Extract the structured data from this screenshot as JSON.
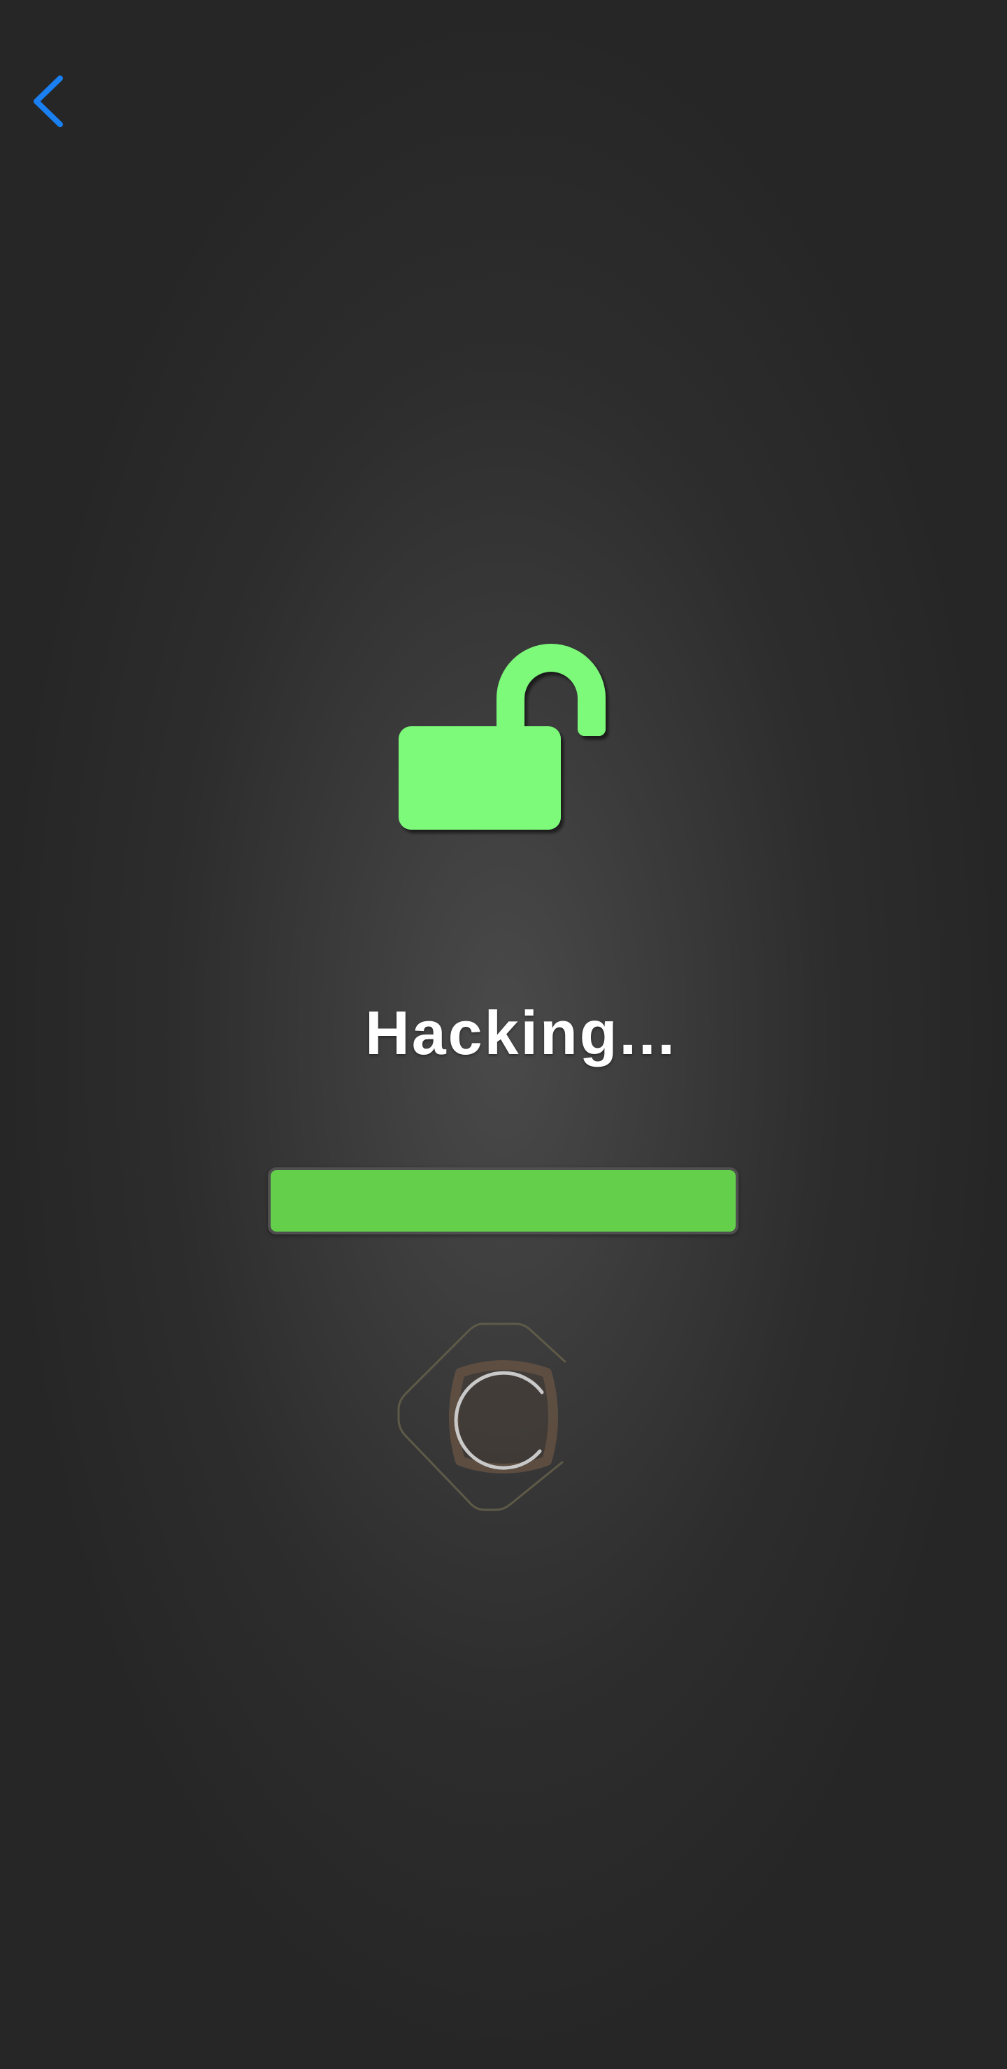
{
  "header": {
    "back_icon": "chevron-left-icon",
    "accent_color": "#1a7ff0"
  },
  "main": {
    "lock_icon": "unlocked-padlock-icon",
    "lock_color": "#7dfa7a",
    "status_text": "Hacking...",
    "progress": {
      "fraction": 1.0,
      "color": "#63cf4a"
    },
    "spinner_icon": "loading-spinner-icon"
  }
}
